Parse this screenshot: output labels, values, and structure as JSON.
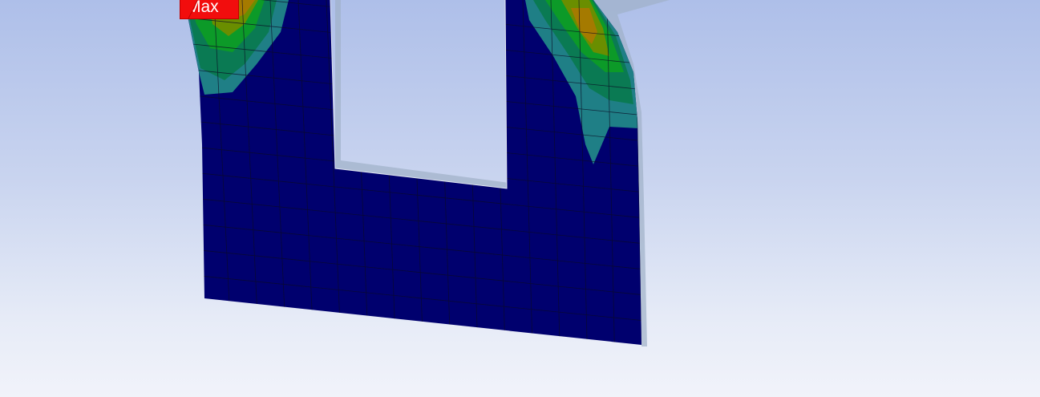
{
  "viewport": {
    "background_top": "#aebfe9",
    "background_bottom": "#f1f3fa"
  },
  "probe": {
    "max_label": "Max",
    "color": "#f20d0d"
  },
  "contour_colors": {
    "low": "#00006e",
    "mid_low": "#1f7f86",
    "mid": "#0c9a28",
    "mid_high": "#6a8e00",
    "high": "#a57a00",
    "peak": "#c43b00"
  }
}
